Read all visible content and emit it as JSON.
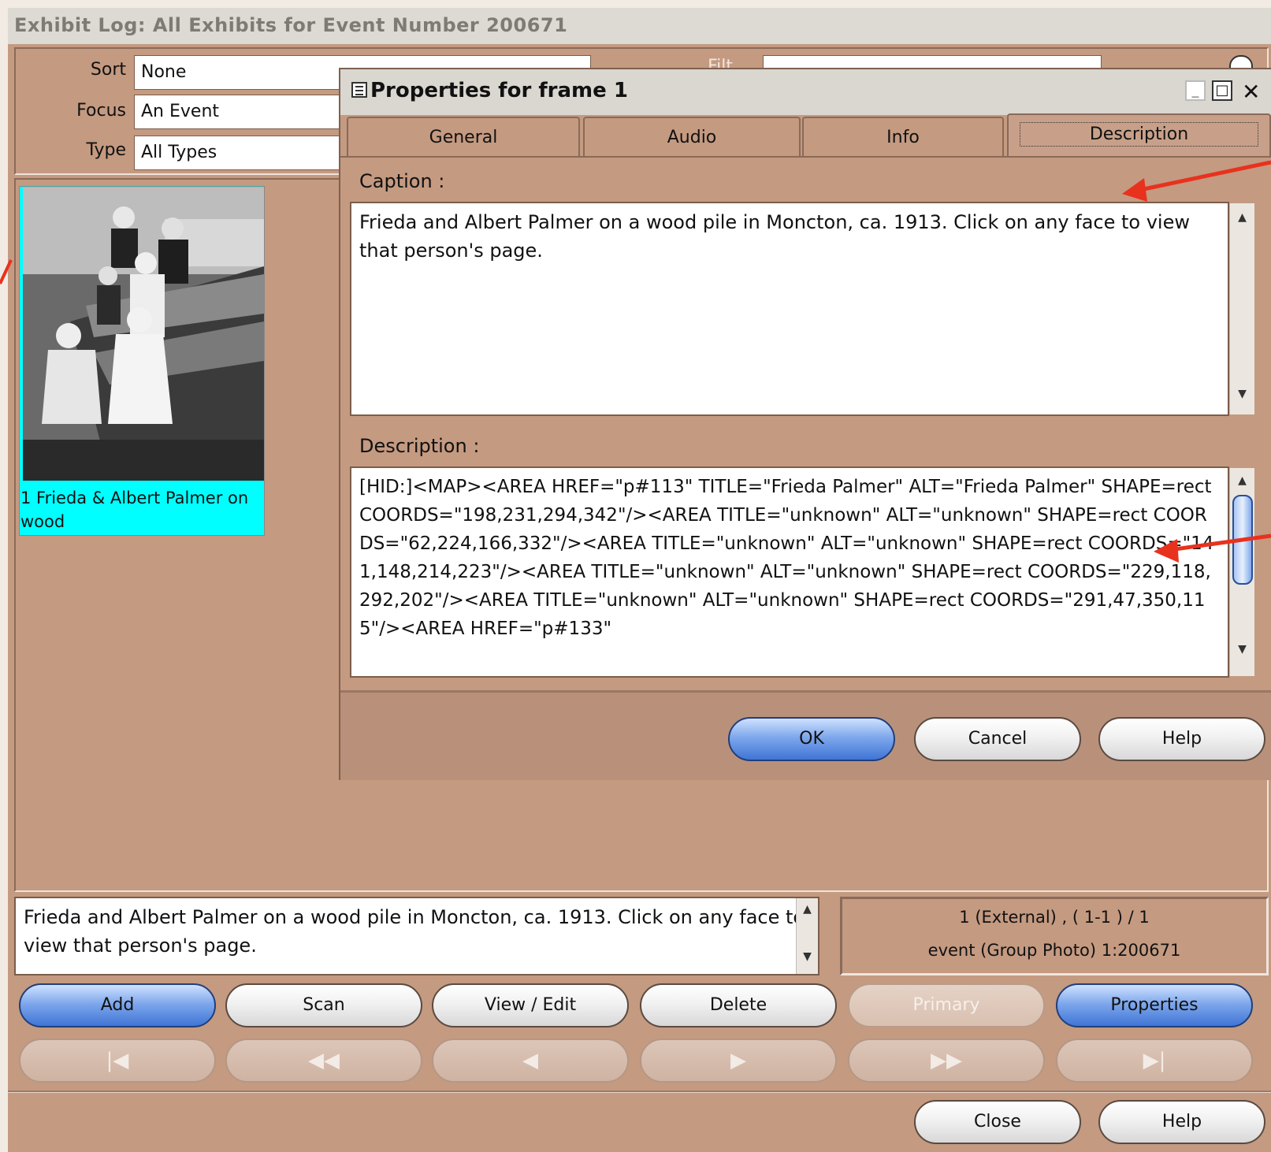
{
  "main": {
    "title": "Exhibit Log: All Exhibits for Event Number 200671",
    "sort_label": "Sort",
    "sort_value": "None",
    "focus_label": "Focus",
    "focus_value": "An Event",
    "type_label": "Type",
    "type_value": "All Types",
    "filter_label": "Filt",
    "thumbnail_caption": "1 Frieda & Albert Palmer on wood",
    "caption_text": "Frieda and Albert Palmer on a wood pile in Moncton, ca. 1913.  Click on any face to view that person's page.",
    "status_line1": "1 (External) , ( 1-1 ) / 1",
    "status_line2": "event (Group Photo) 1:200671",
    "buttons": {
      "add": "Add",
      "scan": "Scan",
      "view_edit": "View / Edit",
      "delete": "Delete",
      "primary": "Primary",
      "properties": "Properties",
      "close": "Close",
      "help": "Help"
    }
  },
  "dialog": {
    "title": "Properties for frame 1",
    "tabs": [
      "General",
      "Audio",
      "Info",
      "Description"
    ],
    "active_tab": "Description",
    "caption_label": "Caption :",
    "caption_text": "Frieda and Albert Palmer on a wood pile in Moncton, ca. 1913.  Click on any face to view that person's page.",
    "description_label": "Description :",
    "description_text": "[HID:]<MAP><AREA HREF=\"p#113\" TITLE=\"Frieda Palmer\" ALT=\"Frieda Palmer\" SHAPE=rect COORDS=\"198,231,294,342\"/><AREA TITLE=\"unknown\" ALT=\"unknown\" SHAPE=rect COORDS=\"62,224,166,332\"/><AREA TITLE=\"unknown\" ALT=\"unknown\" SHAPE=rect COORDS=\"141,148,214,223\"/><AREA TITLE=\"unknown\" ALT=\"unknown\" SHAPE=rect COORDS=\"229,118,292,202\"/><AREA TITLE=\"unknown\" ALT=\"unknown\" SHAPE=rect COORDS=\"291,47,350,115\"/><AREA HREF=\"p#133\"",
    "buttons": {
      "ok": "OK",
      "cancel": "Cancel",
      "help": "Help"
    }
  },
  "colors": {
    "panel": "#c49a81",
    "thumb_highlight": "#00ffff",
    "arrow": "#e8321e",
    "blue_button": "#3f75d6"
  }
}
